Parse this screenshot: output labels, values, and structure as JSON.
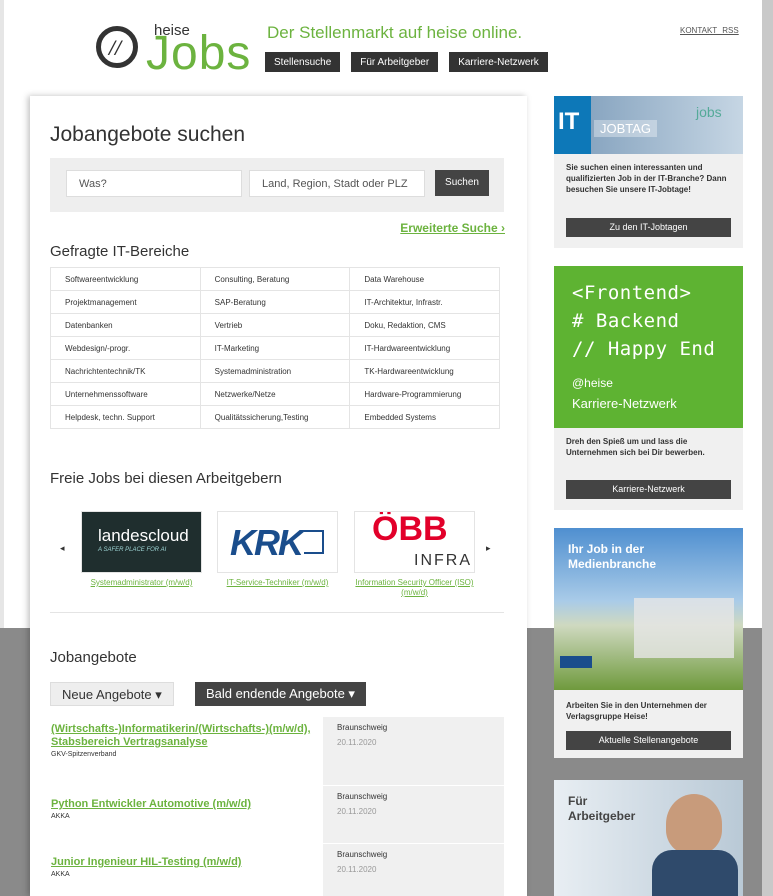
{
  "header": {
    "logo_heise": "heise",
    "logo_jobs": "Jobs",
    "tagline": "Der Stellenmarkt auf heise online.",
    "nav": [
      "Stellensuche",
      "Für Arbeitgeber",
      "Karriere-Netzwerk"
    ],
    "links": "KONTAKT RSS"
  },
  "search": {
    "title": "Jobangebote suchen",
    "what_placeholder": "Was?",
    "where_placeholder": "Land, Region, Stadt oder PLZ",
    "button": "Suchen",
    "advanced": "Erweiterte Suche ›"
  },
  "areas": {
    "title": "Gefragte IT-Bereiche",
    "rows": [
      [
        "Softwareentwicklung",
        "Consulting, Beratung",
        "Data Warehouse"
      ],
      [
        "Projektmanagement",
        "SAP-Beratung",
        "IT-Architektur, Infrastr."
      ],
      [
        "Datenbanken",
        "Vertrieb",
        "Doku, Redaktion, CMS"
      ],
      [
        "Webdesign/-progr.",
        "IT-Marketing",
        "IT-Hardwareentwicklung"
      ],
      [
        "Nachrichtentechnik/TK",
        "Systemadministration",
        "TK-Hardwareentwicklung"
      ],
      [
        "Unternehmenssoftware",
        "Netzwerke/Netze",
        "Hardware-Programmierung"
      ],
      [
        "Helpdesk, techn. Support",
        "Qualitätssicherung,Testing",
        "Embedded Systems"
      ]
    ]
  },
  "employers": {
    "title": "Freie Jobs bei diesen Arbeitgebern",
    "prev": "◂",
    "next": "▸",
    "items": [
      {
        "logo_text": "landescloud",
        "logo_sub": "A SAFER PLACE FOR AI",
        "caption": "Systemadministrator (m/w/d)"
      },
      {
        "logo_text": "KRK",
        "caption": "IT-Service-Techniker (m/w/d)"
      },
      {
        "logo_text": "ÖBB",
        "logo_sub": "INFRA",
        "caption": "Information Security Officer (ISO) (m/w/d)"
      }
    ]
  },
  "jobs": {
    "title": "Jobangebote",
    "tab_new": "Neue Angebote ▾",
    "tab_ending": "Bald endende Angebote ▾",
    "items": [
      {
        "title": "(Wirtschafts-)Informatikerin/(Wirtschafts-)(m/w/d), Stabsbereich Vertragsanalyse",
        "company": "GKV-Spitzenverband",
        "city": "Braunschweig",
        "date": "20.11.2020"
      },
      {
        "title": "Python Entwickler Automotive (m/w/d)",
        "company": "AKKA",
        "city": "Braunschweig",
        "date": "20.11.2020"
      },
      {
        "title": "Junior Ingenieur HIL-Testing (m/w/d)",
        "company": "AKKA",
        "city": "Braunschweig",
        "date": "20.11.2020"
      }
    ]
  },
  "sidebar": {
    "jobtag": {
      "label_it": "IT",
      "label_jobtag": "JOBTAG",
      "brand": "jobs",
      "text": "Sie suchen einen interessanten und qualifizierten Job in der IT-Branche? Dann besuchen Sie unsere IT-Jobtage!",
      "button": "Zu den IT-Jobtagen"
    },
    "network": {
      "line1": "<Frontend>",
      "line2": "# Backend",
      "line3": "// Happy End",
      "line4": "@heise",
      "line5": "Karriere-Netzwerk",
      "text": "Dreh den Spieß um und lass die Unternehmen sich bei Dir bewerben.",
      "button": "Karriere-Netzwerk"
    },
    "media": {
      "headline": "Ihr Job in der Medienbranche",
      "text": "Arbeiten Sie in den Unternehmen der Verlagsgruppe Heise!",
      "button": "Aktuelle Stellenangebote"
    },
    "employer": {
      "headline": "Für Arbeitgeber"
    }
  },
  "colors": {
    "brand_green": "#6cb33f",
    "dark": "#444444"
  }
}
